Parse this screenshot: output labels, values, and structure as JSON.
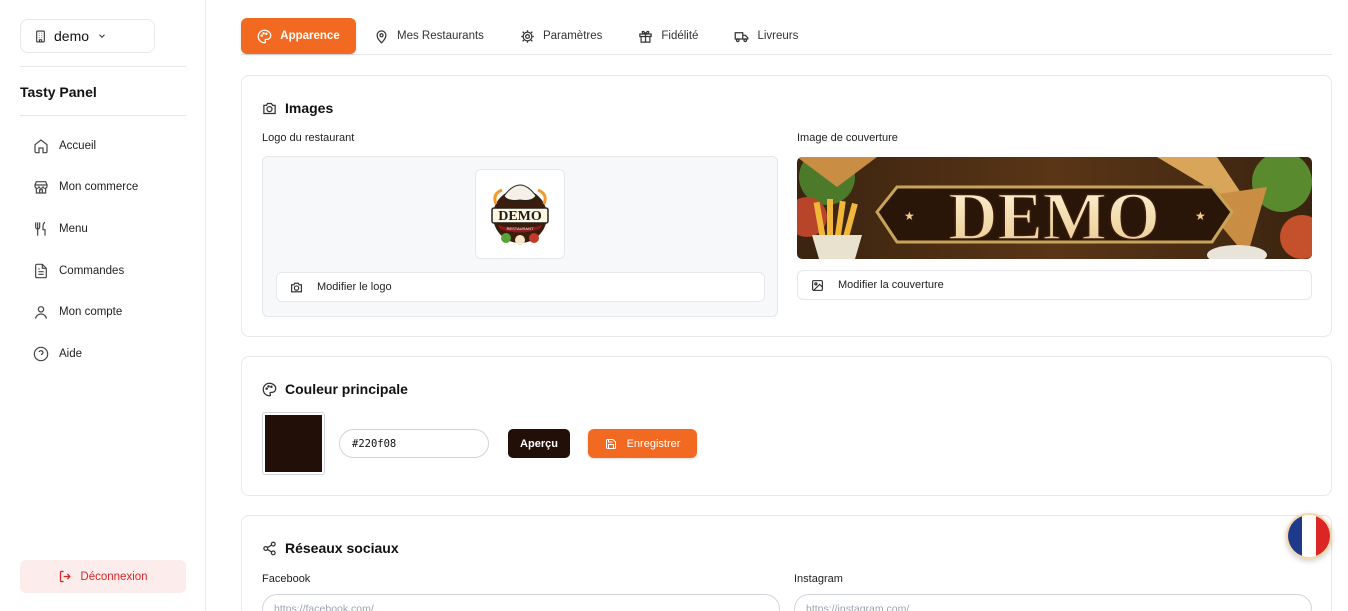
{
  "sidebar": {
    "workspace": "demo",
    "brand": "Tasty Panel",
    "items": [
      {
        "label": "Accueil",
        "icon": "home-icon"
      },
      {
        "label": "Mon commerce",
        "icon": "store-icon"
      },
      {
        "label": "Menu",
        "icon": "utensils-icon"
      },
      {
        "label": "Commandes",
        "icon": "file-text-icon"
      },
      {
        "label": "Mon compte",
        "icon": "user-icon"
      },
      {
        "label": "Aide",
        "icon": "help-circle-icon"
      }
    ],
    "logout": "Déconnexion"
  },
  "tabs": [
    {
      "label": "Apparence",
      "icon": "palette-icon",
      "active": true
    },
    {
      "label": "Mes Restaurants",
      "icon": "map-pin-icon",
      "active": false
    },
    {
      "label": "Paramètres",
      "icon": "gear-icon",
      "active": false
    },
    {
      "label": "Fidélité",
      "icon": "gift-icon",
      "active": false
    },
    {
      "label": "Livreurs",
      "icon": "truck-icon",
      "active": false
    }
  ],
  "images": {
    "title": "Images",
    "logo_label": "Logo du restaurant",
    "logo_button": "Modifier le logo",
    "logo_text": "DEMO",
    "logo_subtext": "RESTAURANT",
    "cover_label": "Image de couverture",
    "cover_button": "Modifier la couverture",
    "cover_text": "DEMO"
  },
  "color": {
    "title": "Couleur principale",
    "value": "#220f08",
    "preview_button": "Aperçu",
    "save_button": "Enregistrer"
  },
  "social": {
    "title": "Réseaux sociaux",
    "facebook_label": "Facebook",
    "facebook_placeholder": "https://facebook.com/...",
    "instagram_label": "Instagram",
    "instagram_placeholder": "https://instagram.com/..."
  },
  "colors": {
    "accent": "#f26a21",
    "primary": "#220f08",
    "danger": "#dc2626"
  }
}
